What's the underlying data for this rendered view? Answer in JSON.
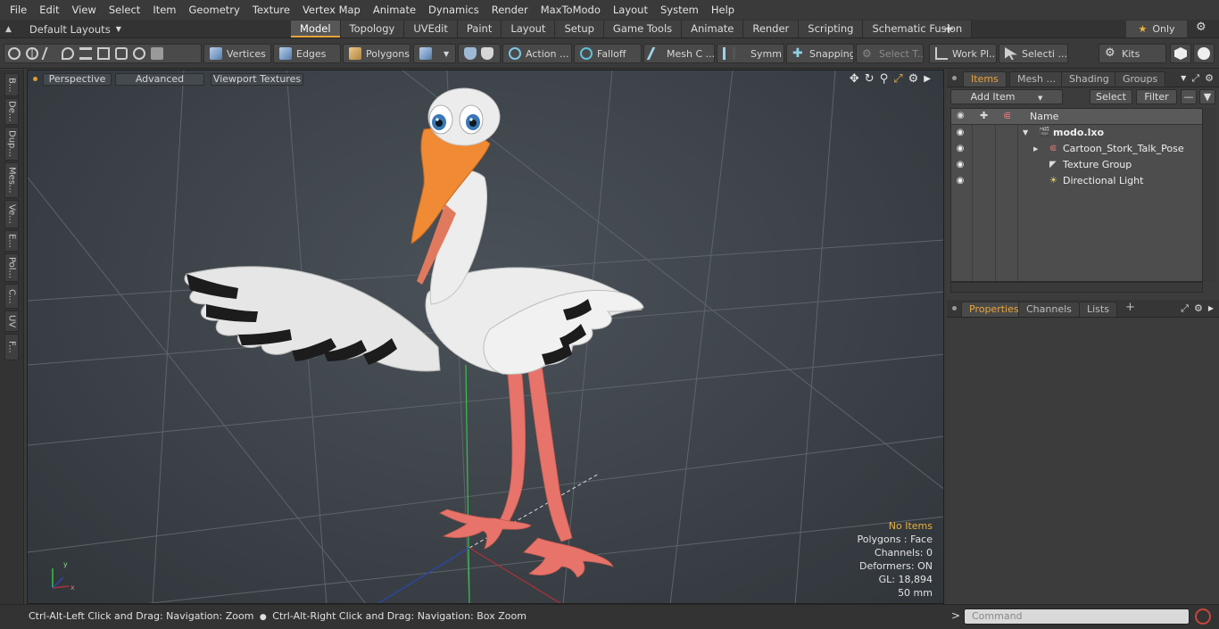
{
  "menu": [
    "File",
    "Edit",
    "View",
    "Select",
    "Item",
    "Geometry",
    "Texture",
    "Vertex Map",
    "Animate",
    "Dynamics",
    "Render",
    "MaxToModo",
    "Layout",
    "System",
    "Help"
  ],
  "layout_selector": "Default Layouts",
  "layout_tabs": [
    "Model",
    "Topology",
    "UVEdit",
    "Paint",
    "Layout",
    "Setup",
    "Game Tools",
    "Animate",
    "Render",
    "Scripting",
    "Schematic Fusion"
  ],
  "active_layout_tab": "Model",
  "only_label": "Only",
  "toolbar": {
    "vertices": "Vertices",
    "edges": "Edges",
    "polygons": "Polygons",
    "action": "Action ...",
    "falloff": "Falloff",
    "mesh_c": "Mesh C ...",
    "symm": "Symm ...",
    "snapping": "Snapping",
    "select_t": "Select T...",
    "work_pl": "Work Pl...",
    "selecti": "Selecti ...",
    "kits": "Kits"
  },
  "left_tabs": [
    "B...",
    "De...",
    "Dup...",
    "Mes...",
    "Ve...",
    "E...",
    "Pol...",
    "C...",
    "UV",
    "F..."
  ],
  "viewport": {
    "perspective": "Perspective",
    "advanced": "Advanced",
    "viewport_textures": "Viewport Textures",
    "stats": {
      "no_items": "No Items",
      "polygons": "Polygons : Face",
      "channels": "Channels: 0",
      "deformers": "Deformers: ON",
      "gl": "GL: 18,894",
      "distance": "50 mm"
    }
  },
  "items_panel": {
    "tabs": [
      "Items",
      "Mesh ...",
      "Shading",
      "Groups"
    ],
    "add_item": "Add Item",
    "select": "Select",
    "filter": "Filter",
    "column_name": "Name",
    "tree": [
      {
        "label": "modo.lxo",
        "bold": true
      },
      {
        "label": "Cartoon_Stork_Talk_Pose"
      },
      {
        "label": "Texture Group"
      },
      {
        "label": "Directional Light"
      }
    ]
  },
  "properties_panel": {
    "tabs": [
      "Properties",
      "Channels",
      "Lists"
    ]
  },
  "status": {
    "hint_left": "Ctrl-Alt-Left Click and Drag: Navigation: Zoom",
    "hint_right": "Ctrl-Alt-Right Click and Drag: Navigation: Box Zoom",
    "command_placeholder": "Command"
  },
  "colors": {
    "accent": "#e8a33b",
    "stork_body": "#ececec",
    "stork_beak": "#f08a34",
    "stork_legs": "#e8736a"
  }
}
